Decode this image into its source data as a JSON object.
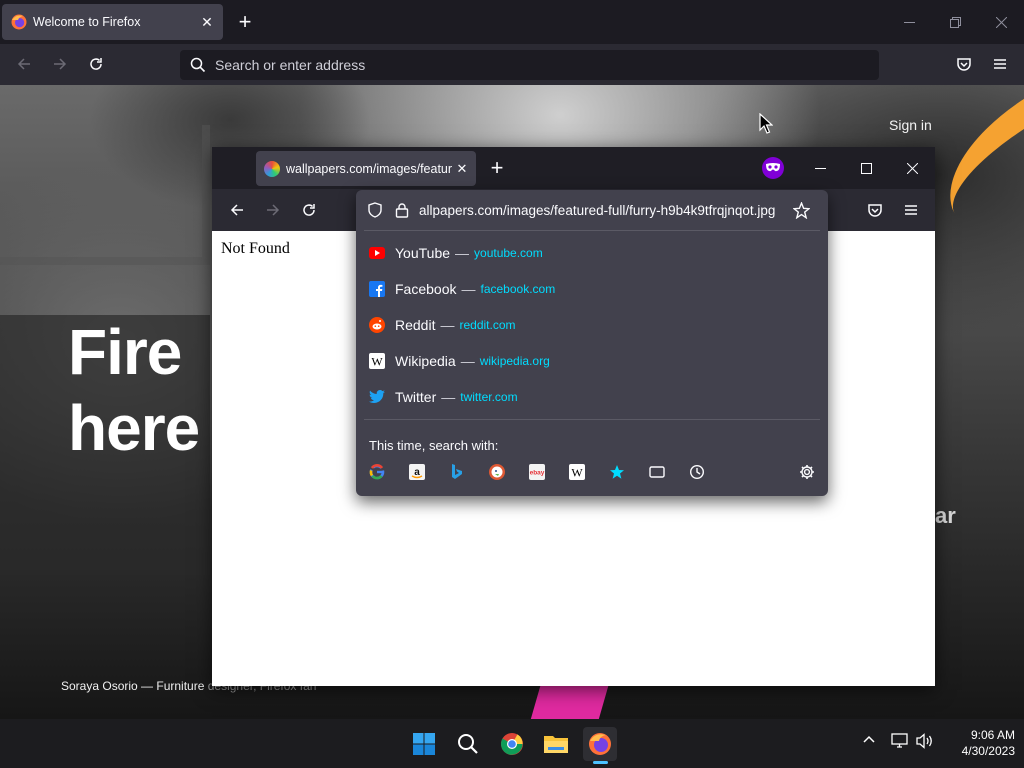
{
  "back_window": {
    "tab_title": "Welcome to Firefox",
    "address_placeholder": "Search or enter address",
    "sign_in": "Sign in",
    "hero_line1": "Fire",
    "hero_line2": "here",
    "hero_right": "ar",
    "credit_name": "Soraya Osorio — Furniture",
    "credit_role": " designer, Firefox fan"
  },
  "front_window": {
    "tab_title": "wallpapers.com/images/featur",
    "page_text": "Not Found"
  },
  "url_popup": {
    "url": "allpapers.com/images/featured-full/furry-h9b4k9tfrqjnqot.jpg",
    "suggestions": [
      {
        "name": "YouTube",
        "url": "youtube.com"
      },
      {
        "name": "Facebook",
        "url": "facebook.com"
      },
      {
        "name": "Reddit",
        "url": "reddit.com"
      },
      {
        "name": "Wikipedia",
        "url": "wikipedia.org"
      },
      {
        "name": "Twitter",
        "url": "twitter.com"
      }
    ],
    "dash": "—",
    "search_with": "This time, search with:",
    "engines": [
      "google-icon",
      "amazon-icon",
      "bing-icon",
      "duckduckgo-icon",
      "ebay-icon",
      "wikipedia-icon",
      "bookmarks-icon",
      "tabs-icon",
      "history-icon",
      "settings-icon"
    ]
  },
  "taskbar": {
    "time": "9:06 AM",
    "date": "4/30/2023"
  },
  "colors": {
    "accent": "#00ddff",
    "toolbar": "#2b2a33",
    "popup": "#42414d",
    "private": "#8000d7"
  }
}
